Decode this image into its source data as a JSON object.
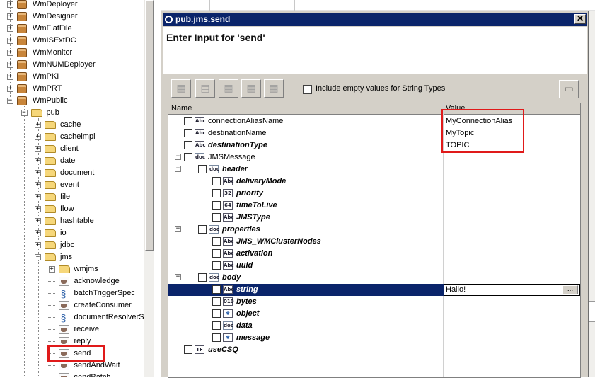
{
  "tree": {
    "items": [
      {
        "label": "WmDeployer",
        "type": "package",
        "expander": "+"
      },
      {
        "label": "WmDesigner",
        "type": "package",
        "expander": "+"
      },
      {
        "label": "WmFlatFile",
        "type": "package",
        "expander": "+"
      },
      {
        "label": "WmISExtDC",
        "type": "package",
        "expander": "+"
      },
      {
        "label": "WmMonitor",
        "type": "package",
        "expander": "+"
      },
      {
        "label": "WmNUMDeployer",
        "type": "package",
        "expander": "+"
      },
      {
        "label": "WmPKI",
        "type": "package",
        "expander": "+"
      },
      {
        "label": "WmPRT",
        "type": "package",
        "expander": "+"
      },
      {
        "label": "WmPublic",
        "type": "package",
        "expander": "−"
      },
      {
        "label": "pub",
        "type": "folder",
        "expander": "−"
      },
      {
        "label": "cache",
        "type": "folder",
        "expander": "+"
      },
      {
        "label": "cacheimpl",
        "type": "folder",
        "expander": "+"
      },
      {
        "label": "client",
        "type": "folder",
        "expander": "+"
      },
      {
        "label": "date",
        "type": "folder",
        "expander": "+"
      },
      {
        "label": "document",
        "type": "folder",
        "expander": "+"
      },
      {
        "label": "event",
        "type": "folder",
        "expander": "+"
      },
      {
        "label": "file",
        "type": "folder",
        "expander": "+"
      },
      {
        "label": "flow",
        "type": "folder",
        "expander": "+"
      },
      {
        "label": "hashtable",
        "type": "folder",
        "expander": "+"
      },
      {
        "label": "io",
        "type": "folder",
        "expander": "+"
      },
      {
        "label": "jdbc",
        "type": "folder",
        "expander": "+"
      },
      {
        "label": "jms",
        "type": "folder",
        "expander": "−"
      },
      {
        "label": "wmjms",
        "type": "folder",
        "expander": "+"
      },
      {
        "label": "acknowledge",
        "type": "service",
        "expander": ""
      },
      {
        "label": "batchTriggerSpec",
        "type": "spec",
        "expander": ""
      },
      {
        "label": "createConsumer",
        "type": "service",
        "expander": ""
      },
      {
        "label": "documentResolverSp",
        "type": "spec",
        "expander": ""
      },
      {
        "label": "receive",
        "type": "service",
        "expander": ""
      },
      {
        "label": "reply",
        "type": "service",
        "expander": ""
      },
      {
        "label": "send",
        "type": "service",
        "expander": ""
      },
      {
        "label": "sendAndWait",
        "type": "service",
        "expander": ""
      },
      {
        "label": "sendBatch",
        "type": "service",
        "expander": ""
      }
    ]
  },
  "dialog": {
    "title": "pub.jms.send",
    "close_label": "✕",
    "header_text": "Enter Input for 'send'",
    "toolbar": {
      "include_empty_label": "Include empty values for String Types",
      "include_empty_checked": false
    },
    "columns": {
      "name": "Name",
      "value": "Value"
    },
    "rows": [
      {
        "name": "connectionAliasName",
        "icon": "Abc",
        "level": 1,
        "bold": false,
        "value": "MyConnectionAlias"
      },
      {
        "name": "destinationName",
        "icon": "Abc",
        "level": 1,
        "bold": false,
        "value": "MyTopic"
      },
      {
        "name": "destinationType",
        "icon": "Abc",
        "level": 1,
        "bold": true,
        "value": "TOPIC"
      },
      {
        "name": "JMSMessage",
        "icon": "doc",
        "level": 0,
        "bold": false,
        "value": "",
        "expander": "−"
      },
      {
        "name": "header",
        "icon": "doc",
        "level": 1,
        "bold": true,
        "value": "",
        "expander": "−"
      },
      {
        "name": "deliveryMode",
        "icon": "Abc",
        "level": 2,
        "bold": true,
        "value": ""
      },
      {
        "name": "priority",
        "icon": "32",
        "level": 2,
        "bold": true,
        "value": ""
      },
      {
        "name": "timeToLive",
        "icon": "64",
        "level": 2,
        "bold": true,
        "value": ""
      },
      {
        "name": "JMSType",
        "icon": "Abc",
        "level": 2,
        "bold": true,
        "value": ""
      },
      {
        "name": "properties",
        "icon": "doc",
        "level": 1,
        "bold": true,
        "value": "",
        "expander": "−"
      },
      {
        "name": "JMS_WMClusterNodes",
        "icon": "Abc",
        "level": 2,
        "bold": true,
        "value": ""
      },
      {
        "name": "activation",
        "icon": "Abc",
        "level": 2,
        "bold": true,
        "value": ""
      },
      {
        "name": "uuid",
        "icon": "Abc",
        "level": 2,
        "bold": true,
        "value": ""
      },
      {
        "name": "body",
        "icon": "doc",
        "level": 1,
        "bold": true,
        "value": "",
        "expander": "−"
      },
      {
        "name": "string",
        "icon": "Abc",
        "level": 2,
        "bold": true,
        "value": "Hallo!",
        "selected": true
      },
      {
        "name": "bytes",
        "icon": "010",
        "level": 2,
        "bold": true,
        "value": ""
      },
      {
        "name": "object",
        "icon": "obj",
        "level": 2,
        "bold": true,
        "value": ""
      },
      {
        "name": "data",
        "icon": "doc",
        "level": 2,
        "bold": true,
        "value": ""
      },
      {
        "name": "message",
        "icon": "obj",
        "level": 2,
        "bold": true,
        "value": ""
      },
      {
        "name": "useCSQ",
        "icon": "TF",
        "level": 0,
        "bold": true,
        "value": ""
      }
    ],
    "selected_value_button": "..."
  },
  "colors": {
    "titlebar": "#0a246a",
    "highlight": "#e01a1a",
    "dialog_bg": "#d4d0c8"
  }
}
